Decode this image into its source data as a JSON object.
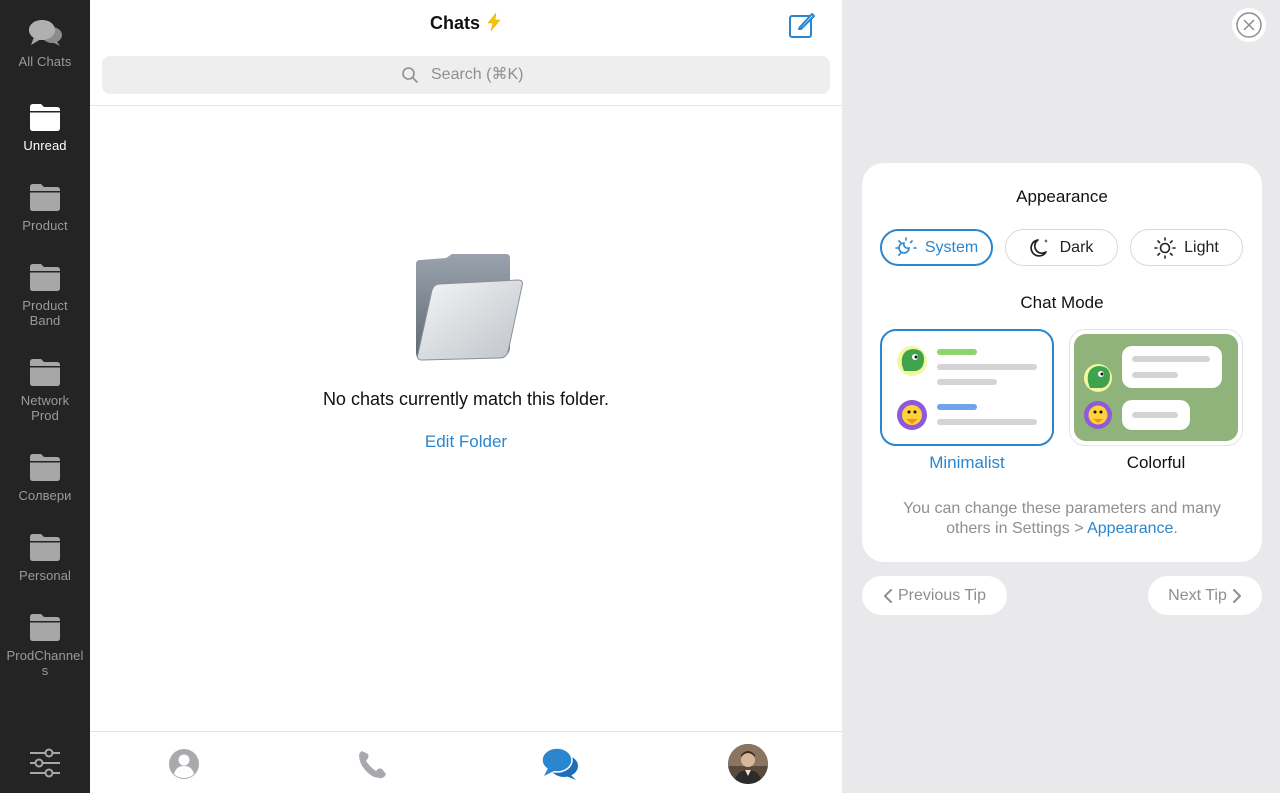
{
  "sidebar": {
    "folders": [
      {
        "label": "All Chats",
        "icon": "chat-bubbles-icon",
        "active": false
      },
      {
        "label": "Unread",
        "icon": "folder-icon",
        "active": true
      },
      {
        "label": "Product",
        "icon": "folder-icon",
        "active": false
      },
      {
        "label": "Product Band",
        "icon": "folder-icon",
        "active": false
      },
      {
        "label": "Network Prod",
        "icon": "folder-icon",
        "active": false
      },
      {
        "label": "Солвери",
        "icon": "folder-icon",
        "active": false
      },
      {
        "label": "Personal",
        "icon": "folder-icon",
        "active": false
      },
      {
        "label": "ProdChannels",
        "icon": "folder-icon",
        "active": false
      }
    ],
    "settings_icon": "sliders-icon"
  },
  "chats": {
    "title": "Chats",
    "search_placeholder": "Search (⌘K)",
    "empty_message": "No chats currently match this folder.",
    "edit_folder_label": "Edit Folder"
  },
  "tabbar": {
    "tabs": [
      "contacts-icon",
      "calls-icon",
      "chats-icon",
      "profile-avatar"
    ],
    "active_tab": "chats-icon"
  },
  "tip": {
    "title": "Appearance",
    "themes": [
      {
        "label": "System",
        "icon": "auto-theme-icon",
        "active": true
      },
      {
        "label": "Dark",
        "icon": "moon-icon",
        "active": false
      },
      {
        "label": "Light",
        "icon": "sun-icon",
        "active": false
      }
    ],
    "chat_mode_title": "Chat Mode",
    "modes": [
      {
        "label": "Minimalist",
        "active": true
      },
      {
        "label": "Colorful",
        "active": false
      }
    ],
    "note_text": "You can change these parameters and many others in Settings > ",
    "note_link": "Appearance",
    "note_end": ".",
    "prev_label": "Previous Tip",
    "next_label": "Next Tip"
  },
  "colors": {
    "accent": "#2a86cf",
    "sidebar_bg": "#242424",
    "panel_bg": "#e9e9eb"
  }
}
